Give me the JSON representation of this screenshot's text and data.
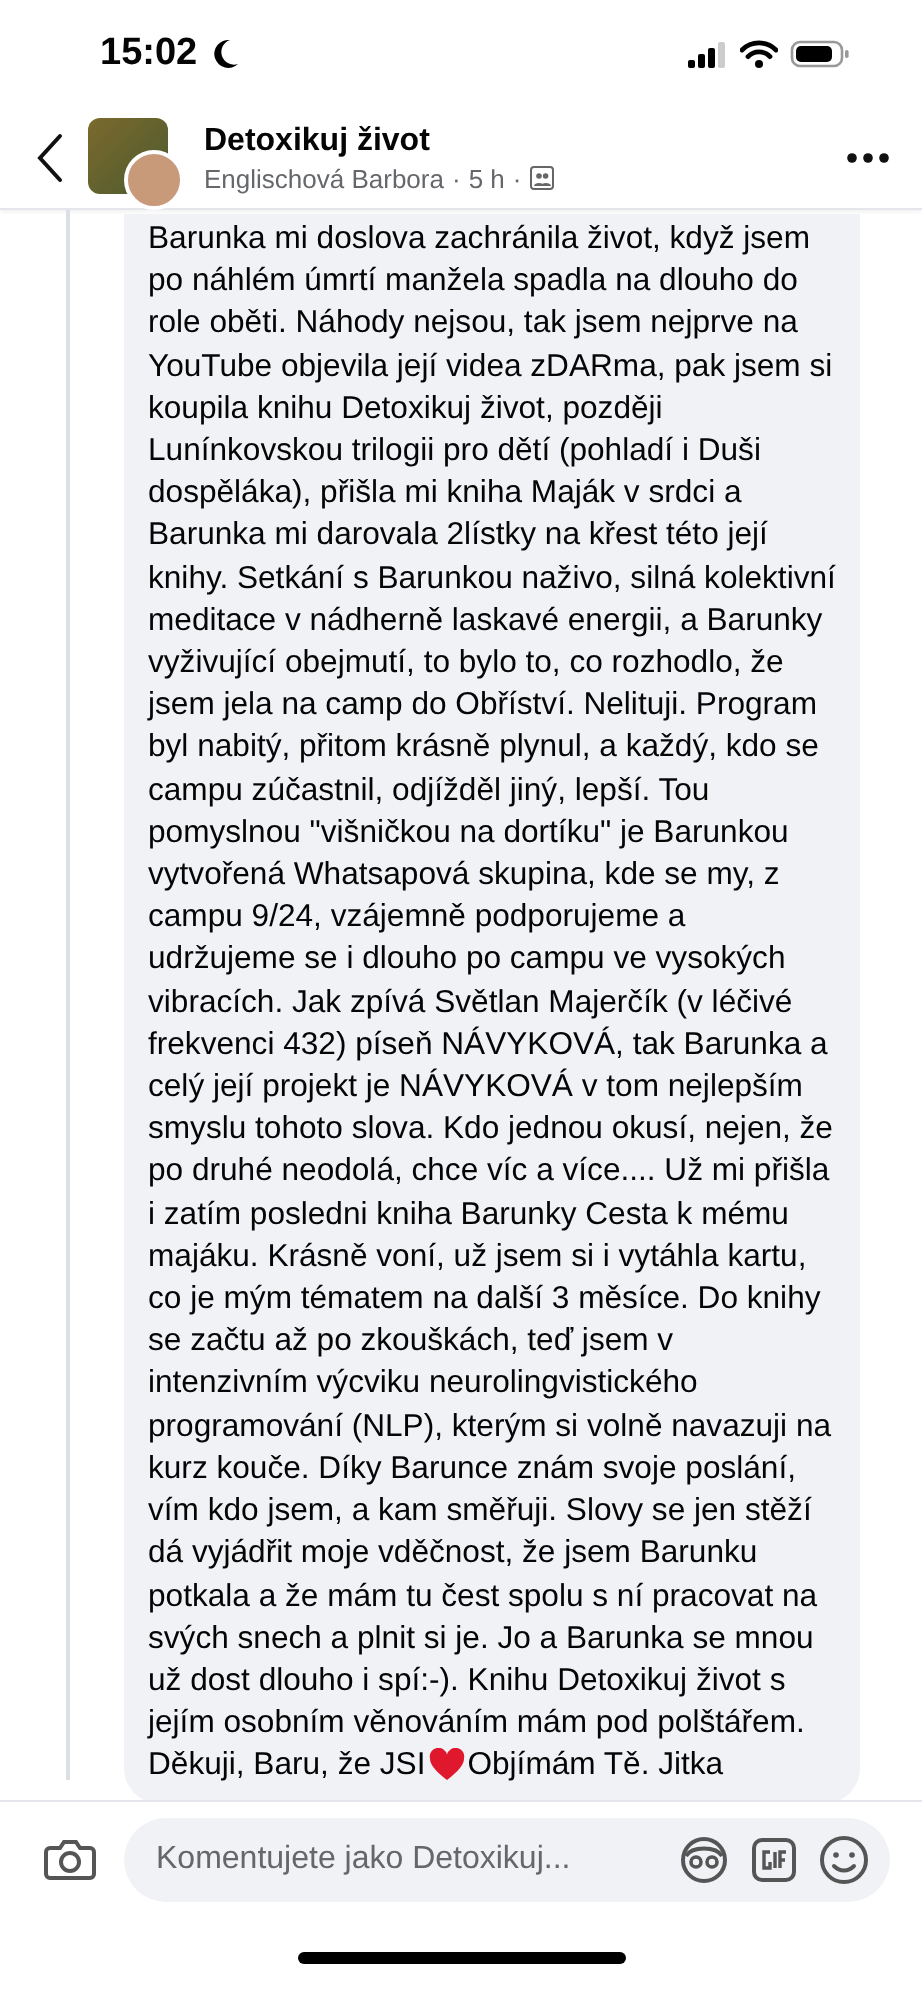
{
  "status_bar": {
    "time": "15:02"
  },
  "header": {
    "title": "Detoxikuj život",
    "author": "Englischová Barbora",
    "age": "5 h",
    "separator": "·"
  },
  "comment": {
    "text": "Barunka mi doslova zachránila život, když jsem\npo náhlém úmrtí manžela spadla na dlouho do\nrole oběti. Náhody nejsou, tak jsem nejprve na\nYouTube objevila její videa zDARma, pak jsem si\nkoupila knihu Detoxikuj  život, později\nLunínkovskou trilogii pro dětí (pohladí i Duši\ndospěláka), přišla mi kniha Maják v srdci a\nBarunka mi darovala 2lístky na křest této její\nknihy. Setkání s Barunkou naživo, silná kolektivní\nmeditace v nádherně laskavé energii, a Barunky\nvyživující obejmutí, to bylo to, co rozhodlo, že\njsem jela na camp do Obříství. Nelituji. Program\nbyl nabitý, přitom krásně plynul, a každý, kdo se\ncampu zúčastnil, odjížděl jiný, lepší. Tou\npomyslnou \"višničkou na dortíku\" je Barunkou\nvytvořená Whatsapová skupina, kde se my, z\ncampu 9/24, vzájemně podporujeme a\nudržujeme se i dlouho po campu ve vysokých\nvibracích. Jak zpívá Světlan Majerčík (v léčivé\nfrekvenci 432) píseň NÁVYKOVÁ, tak Barunka a\ncelý její projekt je  NÁVYKOVÁ v tom nejlepším\nsmyslu tohoto slova. Kdo jednou okusí, nejen, že\npo druhé neodolá,  chce víc a více.... Už mi přišla\ni zatím posledni kniha Barunky Cesta k mému\nmajáku. Krásně voní, už jsem si i vytáhla kartu,\nco je mým tématem na další 3 měsíce. Do knihy\nse začtu až po zkouškách, teď jsem v\nintenzivním výcviku neurolingvistického\nprogramování (NLP), kterým si volně navazuji na\nkurz kouče. Díky Barunce znám svoje poslání,\nvím kdo jsem, a kam směřuji. Slovy se jen stěží\ndá vyjádřit moje vděčnost, že jsem Barunku\npotkala a že mám tu čest spolu s ní pracovat na\nsvých snech a plnit si je. Jo a Barunka se mnou\nuž dost dlouho i spí:-). Knihu Detoxikuj život s\njejím osobním věnováním mám pod polštářem.",
    "closing_before": "Děkuji, Baru, že JSI",
    "closing_after": "Objímám Tě. Jitka"
  },
  "composer": {
    "placeholder": "Komentujete jako Detoxikuj..."
  }
}
